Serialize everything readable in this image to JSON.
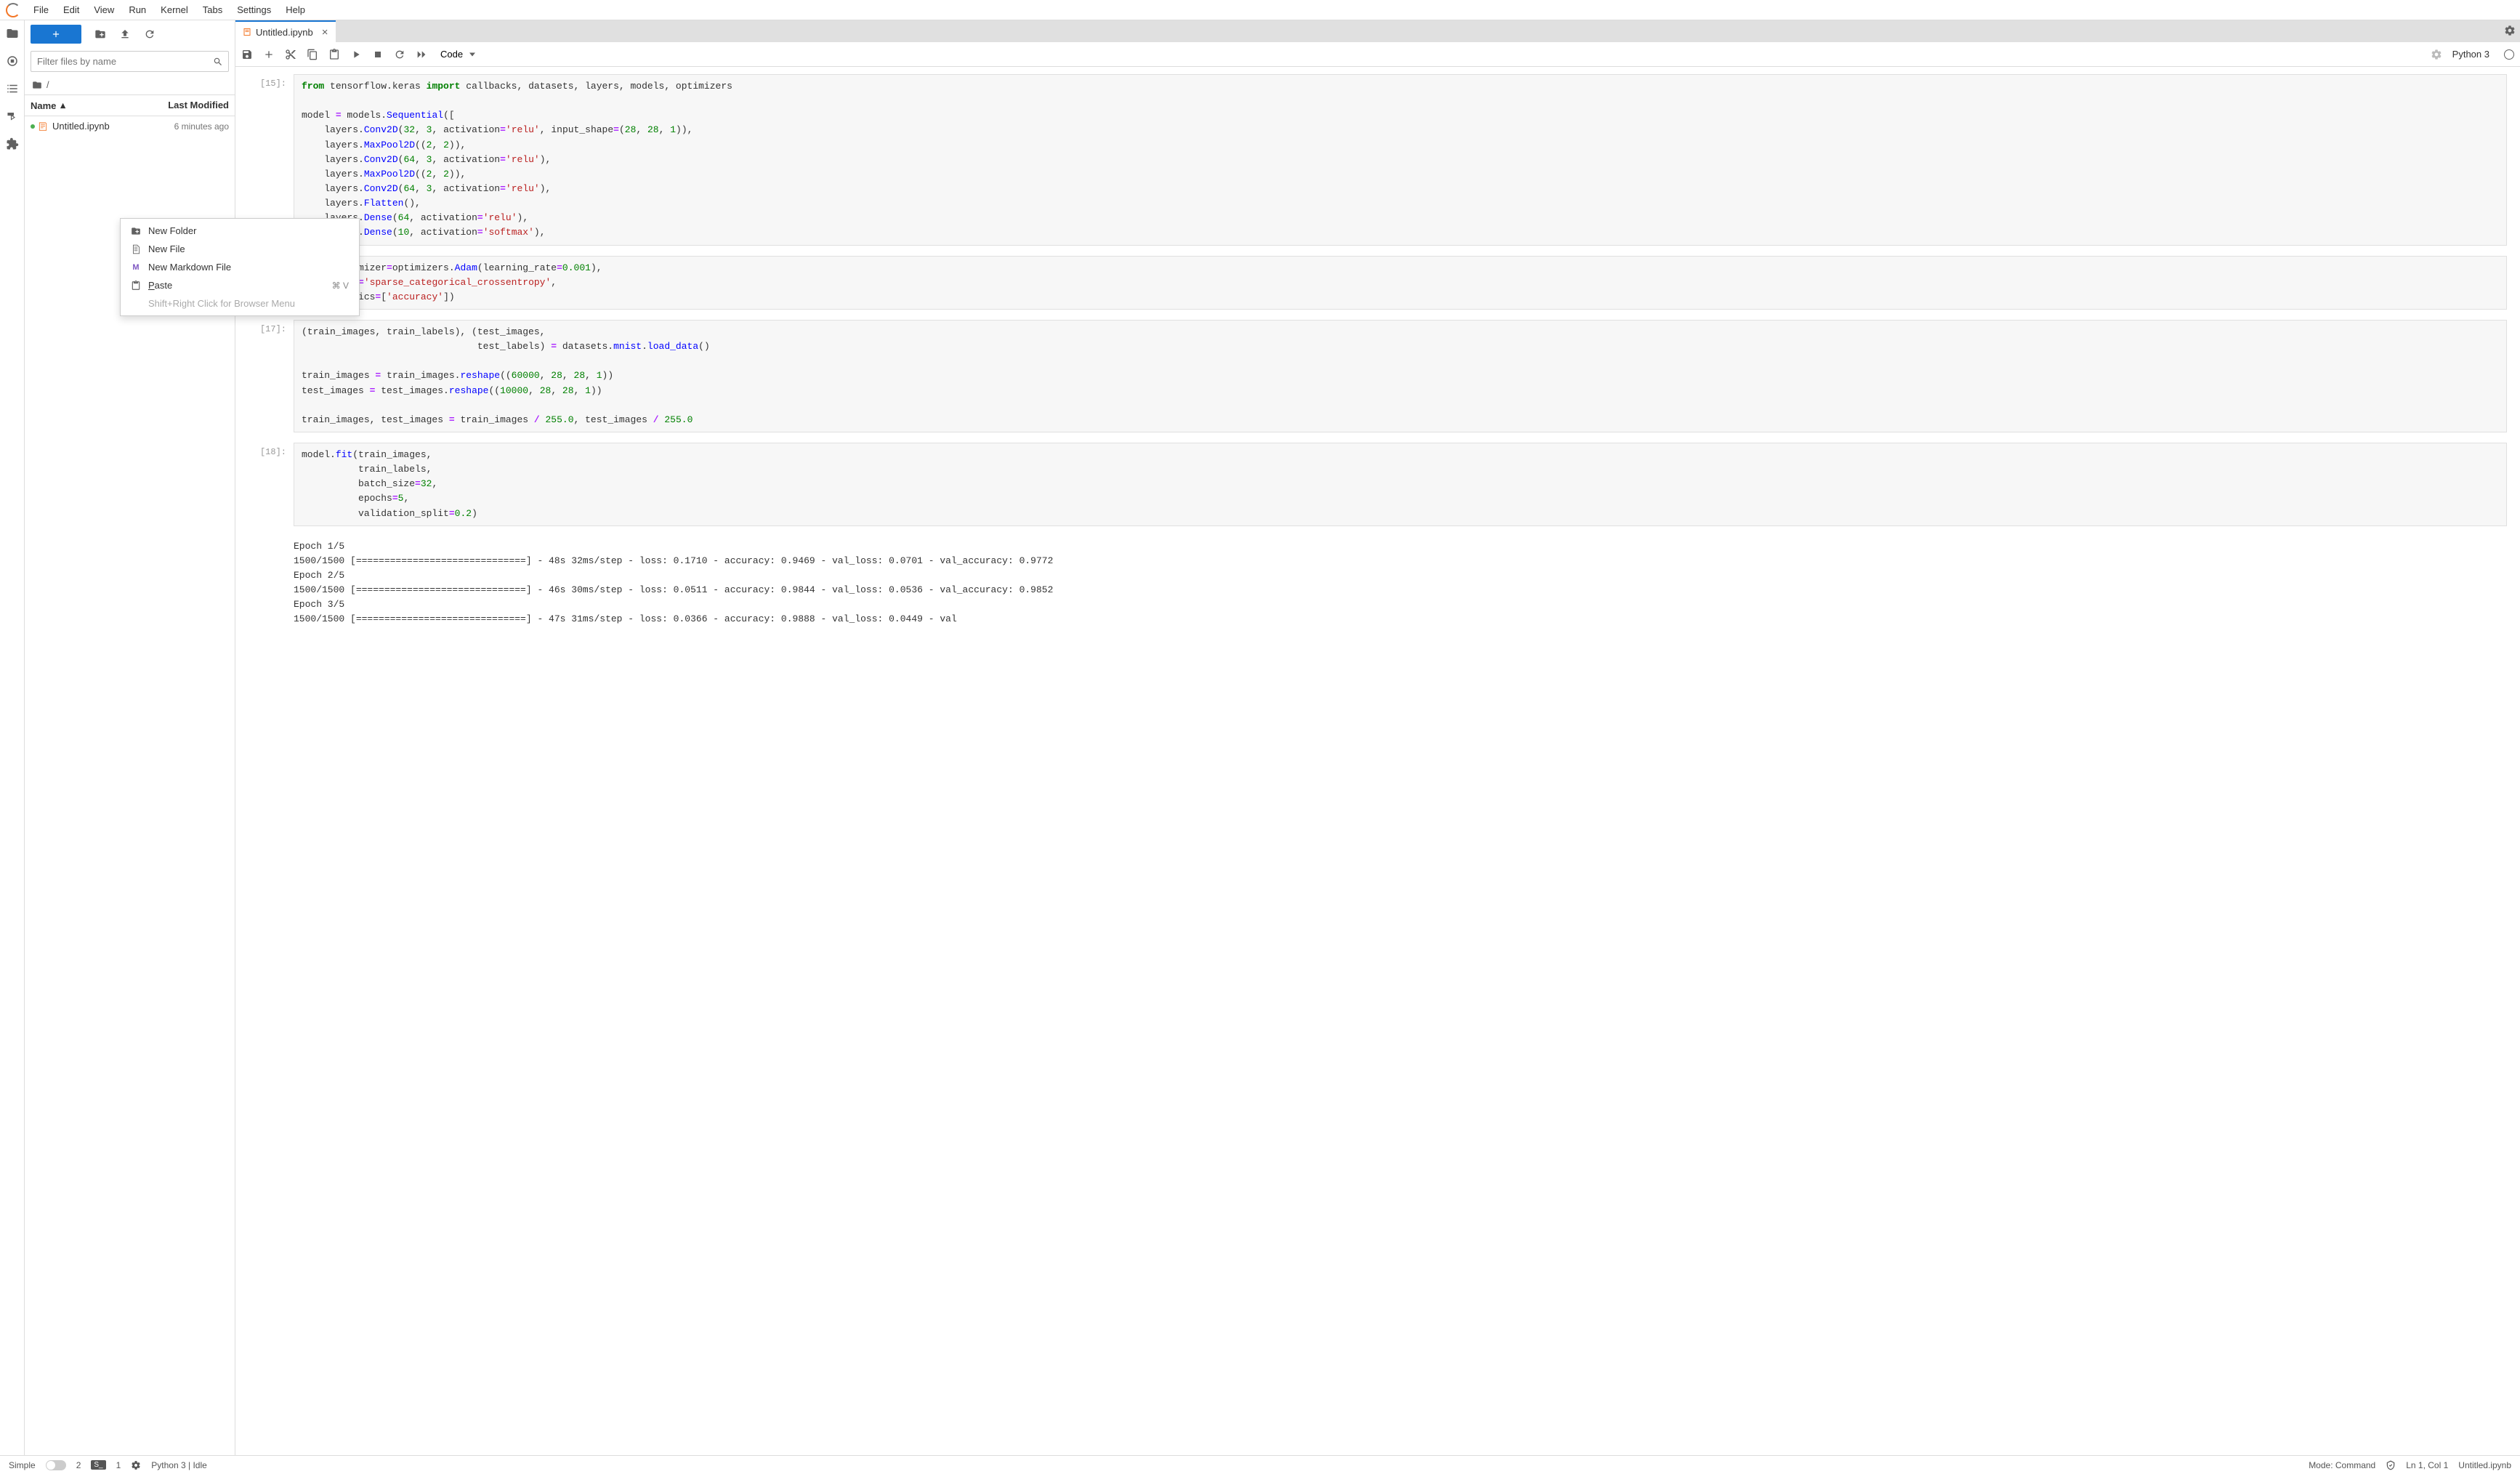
{
  "menu": {
    "items": [
      "File",
      "Edit",
      "View",
      "Run",
      "Kernel",
      "Tabs",
      "Settings",
      "Help"
    ]
  },
  "filepanel": {
    "filter_placeholder": "Filter files by name",
    "breadcrumb": "/",
    "header_name": "Name",
    "header_modified": "Last Modified",
    "files": [
      {
        "name": "Untitled.ipynb",
        "modified": "6 minutes ago",
        "running": true
      }
    ]
  },
  "context_menu": {
    "items": [
      {
        "icon": "folder-plus",
        "label": "New Folder",
        "shortcut": ""
      },
      {
        "icon": "file",
        "label": "New File",
        "shortcut": ""
      },
      {
        "icon": "md",
        "label": "New Markdown File",
        "shortcut": ""
      },
      {
        "icon": "paste",
        "label": "Paste",
        "shortcut": "⌘ V",
        "underline": "P"
      }
    ],
    "hint": "Shift+Right Click for Browser Menu"
  },
  "tab": {
    "title": "Untitled.ipynb"
  },
  "toolbar": {
    "cell_type": "Code",
    "kernel": "Python 3"
  },
  "cells": [
    {
      "prompt": "[15]:",
      "type": "code",
      "html": "<span class='k'>from</span> tensorflow.keras <span class='k'>import</span> callbacks, datasets, layers, models, optimizers\n\nmodel <span class='o'>=</span> models.<span class='nf'>Sequential</span>([\n    layers.<span class='nf'>Conv2D</span>(<span class='mi'>32</span>, <span class='mi'>3</span>, activation<span class='o'>=</span><span class='s'>'relu'</span>, input_shape<span class='o'>=</span>(<span class='mi'>28</span>, <span class='mi'>28</span>, <span class='mi'>1</span>)),\n    layers.<span class='nf'>MaxPool2D</span>((<span class='mi'>2</span>, <span class='mi'>2</span>)),\n    layers.<span class='nf'>Conv2D</span>(<span class='mi'>64</span>, <span class='mi'>3</span>, activation<span class='o'>=</span><span class='s'>'relu'</span>),\n    layers.<span class='nf'>MaxPool2D</span>((<span class='mi'>2</span>, <span class='mi'>2</span>)),\n    layers.<span class='nf'>Conv2D</span>(<span class='mi'>64</span>, <span class='mi'>3</span>, activation<span class='o'>=</span><span class='s'>'relu'</span>),\n    layers.<span class='nf'>Flatten</span>(),\n    layers.<span class='nf'>Dense</span>(<span class='mi'>64</span>, activation<span class='o'>=</span><span class='s'>'relu'</span>),\n    layers.<span class='nf'>Dense</span>(<span class='mi'>10</span>, activation<span class='o'>=</span><span class='s'>'softmax'</span>),"
    },
    {
      "prompt": "",
      "type": "code",
      "html": "mpile(optimizer<span class='o'>=</span>optimizers.<span class='nf'>Adam</span>(learning_rate<span class='o'>=</span><span class='mi'>0.001</span>),\n      loss<span class='o'>=</span><span class='s'>'sparse_categorical_crossentropy'</span>,\n      metrics<span class='o'>=</span>[<span class='s'>'accuracy'</span>])"
    },
    {
      "prompt": "[17]:",
      "type": "code",
      "html": "(train_images, train_labels), (test_images,\n                               test_labels) <span class='o'>=</span> datasets.<span class='nf'>mnist</span>.<span class='nf'>load_data</span>()\n\ntrain_images <span class='o'>=</span> train_images.<span class='nf'>reshape</span>((<span class='mi'>60000</span>, <span class='mi'>28</span>, <span class='mi'>28</span>, <span class='mi'>1</span>))\ntest_images <span class='o'>=</span> test_images.<span class='nf'>reshape</span>((<span class='mi'>10000</span>, <span class='mi'>28</span>, <span class='mi'>28</span>, <span class='mi'>1</span>))\n\ntrain_images, test_images <span class='o'>=</span> train_images <span class='o'>/</span> <span class='mi'>255.0</span>, test_images <span class='o'>/</span> <span class='mi'>255.0</span>"
    },
    {
      "prompt": "[18]:",
      "type": "code",
      "html": "model.<span class='nf'>fit</span>(train_images,\n          train_labels,\n          batch_size<span class='o'>=</span><span class='mi'>32</span>,\n          epochs<span class='o'>=</span><span class='mi'>5</span>,\n          validation_split<span class='o'>=</span><span class='mi'>0.2</span>)"
    },
    {
      "prompt": "",
      "type": "output",
      "text": "Epoch 1/5\n1500/1500 [==============================] - 48s 32ms/step - loss: 0.1710 - accuracy: 0.9469 - val_loss: 0.0701 - val_accuracy: 0.9772\nEpoch 2/5\n1500/1500 [==============================] - 46s 30ms/step - loss: 0.0511 - accuracy: 0.9844 - val_loss: 0.0536 - val_accuracy: 0.9852\nEpoch 3/5\n1500/1500 [==============================] - 47s 31ms/step - loss: 0.0366 - accuracy: 0.9888 - val_loss: 0.0449 - val"
    }
  ],
  "statusbar": {
    "simple": "Simple",
    "count1": "2",
    "count2": "1",
    "kernel_status": "Python 3 | Idle",
    "mode": "Mode: Command",
    "cursor": "Ln 1, Col 1",
    "filename": "Untitled.ipynb"
  }
}
